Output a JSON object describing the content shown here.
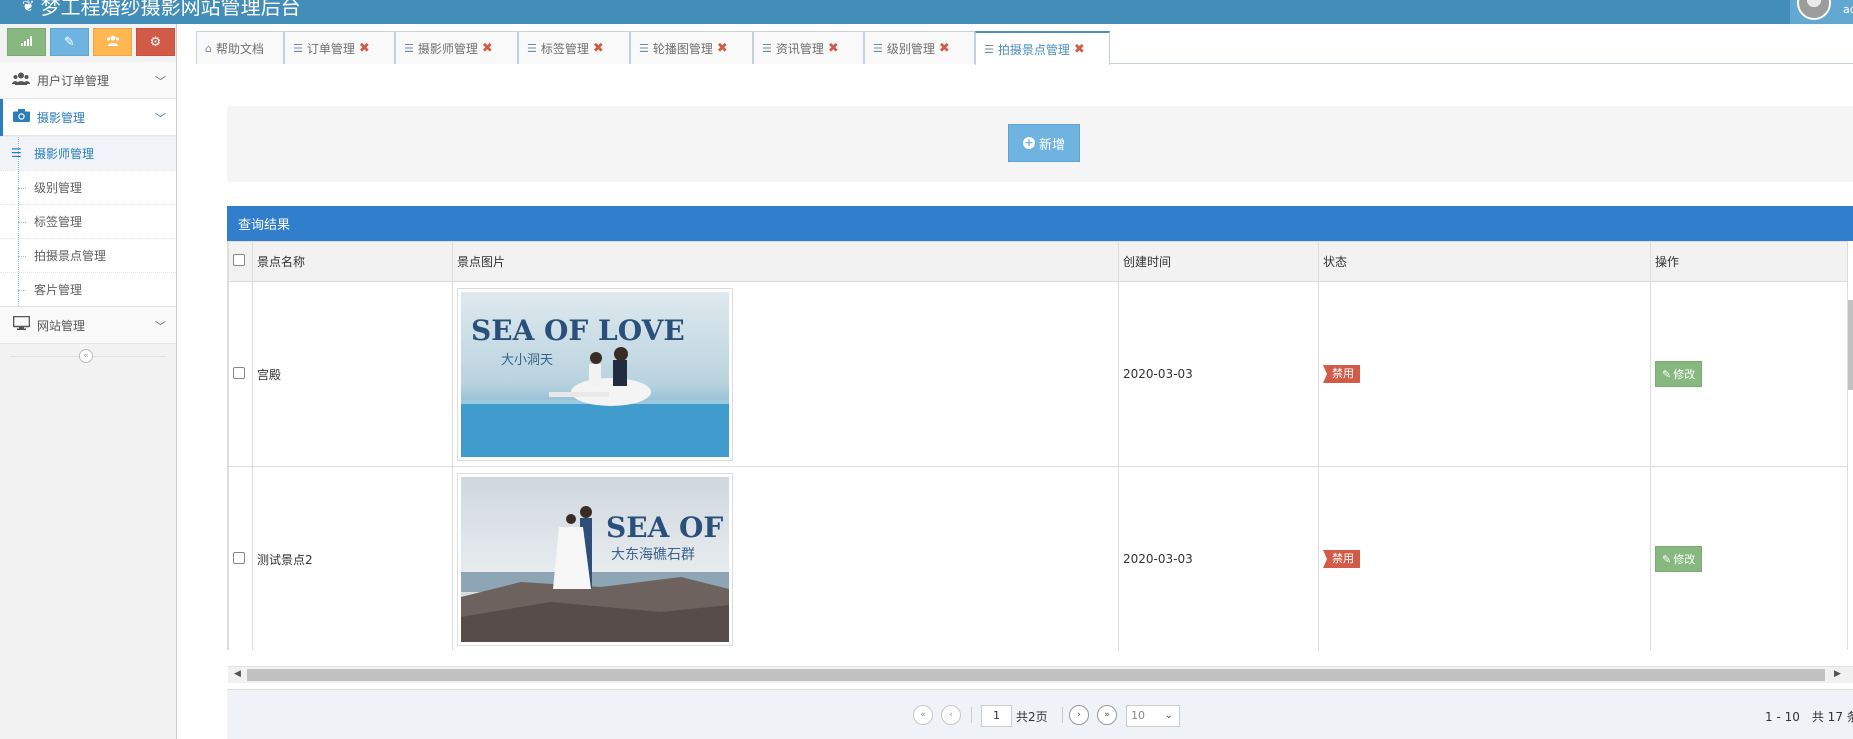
{
  "header": {
    "title": "梦工程婚纱摄影网站管理后台",
    "user_name": "ad"
  },
  "sidebar": {
    "shortcuts": [
      {
        "name": "signal-icon"
      },
      {
        "name": "pencil-icon"
      },
      {
        "name": "users-icon"
      },
      {
        "name": "cogs-icon"
      }
    ],
    "menus": [
      {
        "label": "用户订单管理",
        "icon": "users-icon",
        "open": false
      },
      {
        "label": "摄影管理",
        "icon": "camera-icon",
        "open": true,
        "items": [
          {
            "label": "摄影师管理",
            "active": true
          },
          {
            "label": "级别管理",
            "active": false
          },
          {
            "label": "标签管理",
            "active": false
          },
          {
            "label": "拍摄景点管理",
            "active": false
          },
          {
            "label": "客片管理",
            "active": false
          }
        ]
      },
      {
        "label": "网站管理",
        "icon": "desktop-icon",
        "open": false
      }
    ]
  },
  "tabs": [
    {
      "label": "帮助文档",
      "closable": false,
      "icon": "home-icon"
    },
    {
      "label": "订单管理",
      "closable": true,
      "icon": "sliders-icon"
    },
    {
      "label": "摄影师管理",
      "closable": true,
      "icon": "sliders-icon"
    },
    {
      "label": "标签管理",
      "closable": true,
      "icon": "sliders-icon"
    },
    {
      "label": "轮播图管理",
      "closable": true,
      "icon": "sliders-icon"
    },
    {
      "label": "资讯管理",
      "closable": true,
      "icon": "sliders-icon"
    },
    {
      "label": "级别管理",
      "closable": true,
      "icon": "sliders-icon"
    },
    {
      "label": "拍摄景点管理",
      "closable": true,
      "icon": "sliders-icon",
      "active": true
    }
  ],
  "toolbar": {
    "add_label": "新增"
  },
  "panel": {
    "title": "查询结果"
  },
  "table": {
    "columns": [
      "景点名称",
      "景点图片",
      "创建时间",
      "状态",
      "操作"
    ],
    "rows": [
      {
        "name": "宫殿",
        "photo_title": "SEA OF LOVE",
        "photo_subtitle": "大小洞天",
        "created": "2020-03-03",
        "status": "禁用",
        "action": "修改"
      },
      {
        "name": "测试景点2",
        "photo_title": "SEA OF LOVE",
        "photo_subtitle": "大东海礁石群",
        "created": "2020-03-03",
        "status": "禁用",
        "action": "修改"
      }
    ]
  },
  "pager": {
    "current_page": "1",
    "total_pages": "共2页",
    "page_size": "10",
    "info": "1 - 10　共 17 条"
  },
  "colors": {
    "navbar": "#438eb9",
    "panel_head": "#307ecc",
    "success": "#87b87f",
    "danger": "#d15b47",
    "info": "#6fb3e0",
    "warning": "#ffb752"
  }
}
